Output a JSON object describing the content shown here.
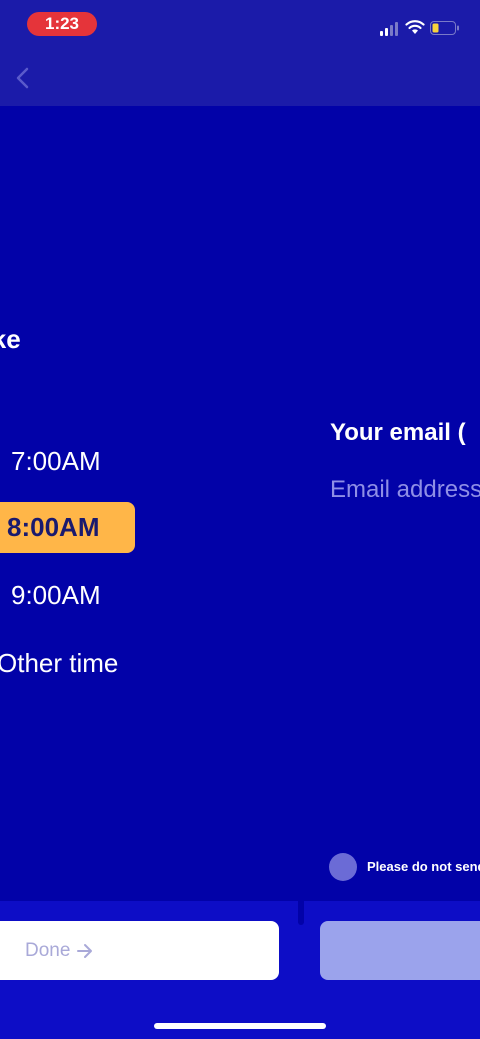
{
  "status_bar": {
    "time": "1:23"
  },
  "wake_screen": {
    "question": "u wake\ny?",
    "options": [
      "7:00AM",
      "8:00AM",
      "9:00AM",
      "Other time"
    ],
    "selected_index": 1
  },
  "email_screen": {
    "title": "Your email (",
    "placeholder": "Email address",
    "consent_label": "Please do not send"
  },
  "bottom": {
    "done_label": "Done"
  },
  "colors": {
    "background": "#0202A8",
    "nav": "#1B1BA9",
    "selected": "#FFB648",
    "time_pill": "#E5343A",
    "disabled_button": "#9BA3EC"
  }
}
